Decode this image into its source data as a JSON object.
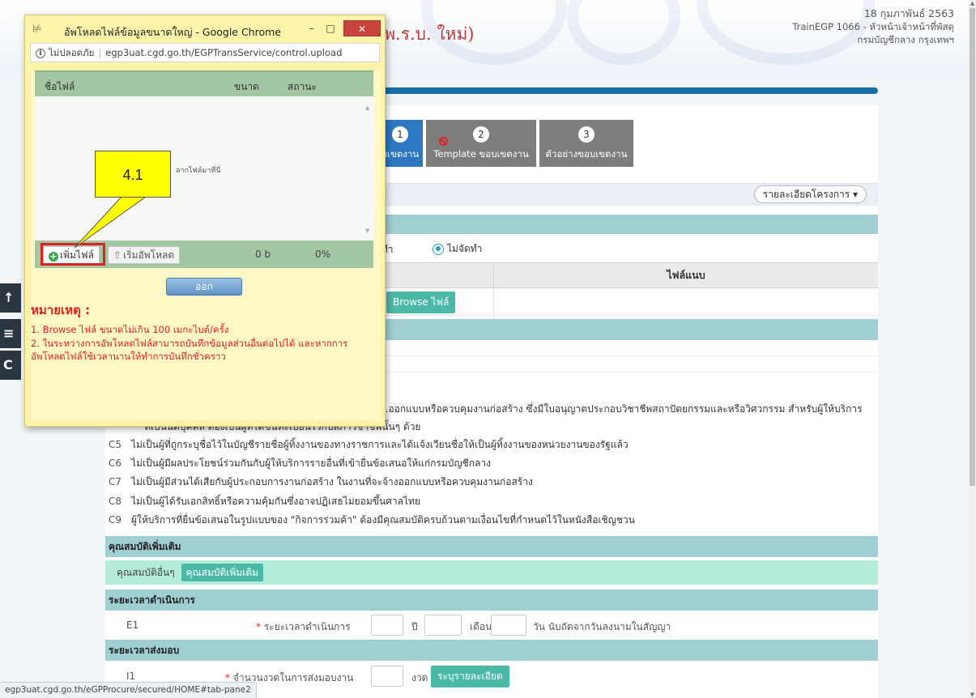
{
  "header": {
    "title_fragment": "(พ.ร.บ. ใหม่)",
    "date": "18 กุมภาพันธ์ 2563",
    "user": "TrainEGP 1066 - หัวหน้าเจ้าหน้าที่พัสดุ",
    "department": "กรมบัญชีกลาง กรุงเทพฯ"
  },
  "steps": [
    {
      "num": "1",
      "label": "บเขตงาน"
    },
    {
      "num": "2",
      "label": "Template ขอบเขตงาน"
    },
    {
      "num": "3",
      "label": "ตัวอย่างขอบเขตงาน"
    }
  ],
  "project_details_button": "รายละเอียดโครงการ ▾",
  "radio_options": {
    "option_a": "จัดทำ",
    "option_b": "ไม่จัดทำ"
  },
  "file_table": {
    "attachment_header": "ไฟล์แนบ",
    "browse_label": "Browse ไฟล์",
    "browse_prefix": "ม"
  },
  "conditions": {
    "c4_line1": "...ออกแบบหรือควบคุมงานก่อสร้าง ซึ่งมีใบอนุญาตประกอบวิชาชีพสถาปัตยกรรมและหรือวิศวกรรม สำหรับผู้ให้บริการ",
    "c4_line2": "ที่เป็นนิติบุคคล ต้องเป็นผู้ที่ได้ขึ้นทะเบียนไว้กับสภาวิชาชีพนั้นๆ ด้วย",
    "items": [
      {
        "code": "C5",
        "text": "ไม่เป็นผู้ที่ถูกระบุชื่อไว้ในบัญชีรายชื่อผู้ทิ้งงานของทางราชการและได้แจ้งเวียนชื่อให้เป็นผู้ทิ้งงานของหน่วยงานของรัฐแล้ว"
      },
      {
        "code": "C6",
        "text": "ไม่เป็นผู้มีผลประโยชน์ร่วมกันกับผู้ให้บริการรายอื่นที่เข้ายื่นข้อเสนอให้แก่กรมบัญชีกลาง"
      },
      {
        "code": "C7",
        "text": "ไม่เป็นผู้มีส่วนได้เสียกับผู้ประกอบการงานก่อสร้าง ในงานที่จะจ้างออกแบบหรือควบคุมงานก่อสร้าง"
      },
      {
        "code": "C8",
        "text": "ไม่เป็นผู้ได้รับเอกสิทธิ์หรือความคุ้มกันซึ่งอาจปฏิเสธไม่ยอมขึ้นศาลไทย"
      },
      {
        "code": "C9",
        "text": "ผู้ให้บริการที่ยื่นข้อเสนอในรูปแบบของ \"กิจการร่วมค้า\" ต้องมีคุณสมบัติครบถ้วนตามเงื่อนไขที่กำหนดไว้ในหนังสือเชิญชวน"
      }
    ]
  },
  "extra_qual": {
    "header": "คุณสมบัติเพิ่มเติม",
    "label": "คุณสมบัติอื่นๆ",
    "button": "คุณสมบัติเพิ่มเติม"
  },
  "duration": {
    "header": "ระยะเวลาดำเนินการ",
    "code": "E1",
    "label": "ระยะเวลาดำเนินการ",
    "year": "ปี",
    "month": "เดือน",
    "day_suffix": "วัน นับถัดจากวันลงนามในสัญญา"
  },
  "delivery": {
    "header": "ระยะเวลาส่งมอบ",
    "code": "I1",
    "label": "จำนวนงวดในการส่งมอบงาน",
    "unit": "งวด",
    "button": "ระบุรายละเอียด"
  },
  "left_tabs": [
    "↑",
    "≡",
    "C"
  ],
  "status_url": "egp3uat.cgd.go.th/eGPProcure/secured/HOME#tab-pane2",
  "popup": {
    "title": "อัพโหลดไฟล์ข้อมูลขนาดใหญ่ - Google Chrome",
    "insecure": "ไม่ปลอดภัย",
    "url": "egp3uat.cgd.go.th/EGPTransService/control.upload",
    "col_name": "ชื่อไฟล์",
    "col_size": "ขนาด",
    "col_status": "สถานะ",
    "drop_hint": "ลากไฟล์มาที่นี่",
    "add_button": "เพิ่มไฟล์",
    "start_button": "เริ่มอัพโหลด",
    "total_size": "0 b",
    "progress": "0%",
    "exit_button": "ออก",
    "note_title": "หมายเหตุ :",
    "note_1": "1. Browse ไฟล์ ขนาดไม่เกิน 100 เมกะไบต์/ครั้ง",
    "note_2": "2. ในระหว่างการอัพโหลดไฟล์สามารถบันทึกข้อมูลส่วนอื่นต่อไปได้ และหากการอัพโหลดไฟล์ใช้เวลานานให้ทำการบันทึกชั่วคราว"
  },
  "callout": {
    "label": "4.1"
  },
  "colors": {
    "accent_blue": "#1a6fa8",
    "teal": "#a0cfd3",
    "callout": "#ffff00",
    "popup_bg": "#fdf3a9",
    "note_red": "#e0201e"
  }
}
